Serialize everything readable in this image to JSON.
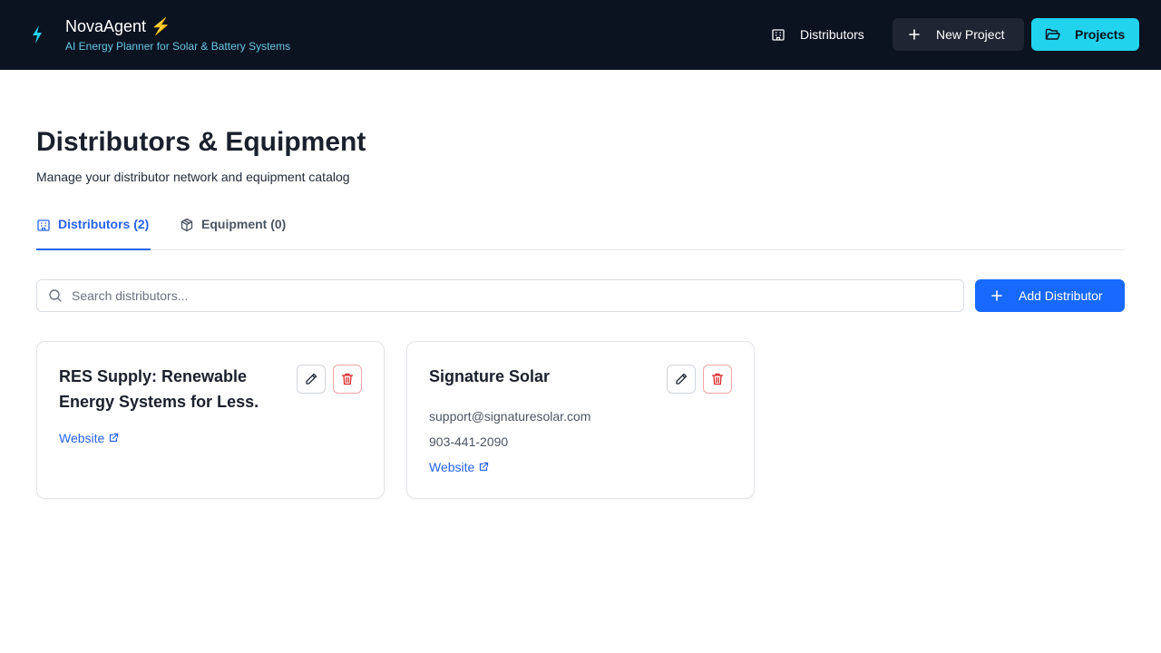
{
  "header": {
    "app_name": "NovaAgent ⚡",
    "tagline": "AI Energy Planner for Solar & Battery Systems",
    "nav_distributors": "Distributors",
    "new_project": "New Project",
    "projects": "Projects",
    "colors": {
      "bg": "#0b1220",
      "accent": "#22d3ee"
    }
  },
  "page": {
    "title": "Distributors & Equipment",
    "subtitle": "Manage your distributor network and equipment catalog"
  },
  "tabs": [
    {
      "label": "Distributors (2)",
      "icon": "building-icon",
      "active": true
    },
    {
      "label": "Equipment (0)",
      "icon": "package-icon",
      "active": false
    }
  ],
  "search": {
    "placeholder": "Search distributors...",
    "value": ""
  },
  "add_button": "Add Distributor",
  "distributors": [
    {
      "name": "RES Supply: Renewable Energy Systems for Less.",
      "email": "",
      "phone": "",
      "website_label": "Website"
    },
    {
      "name": "Signature Solar",
      "email": "support@signaturesolar.com",
      "phone": "903-441-2090",
      "website_label": "Website"
    }
  ]
}
